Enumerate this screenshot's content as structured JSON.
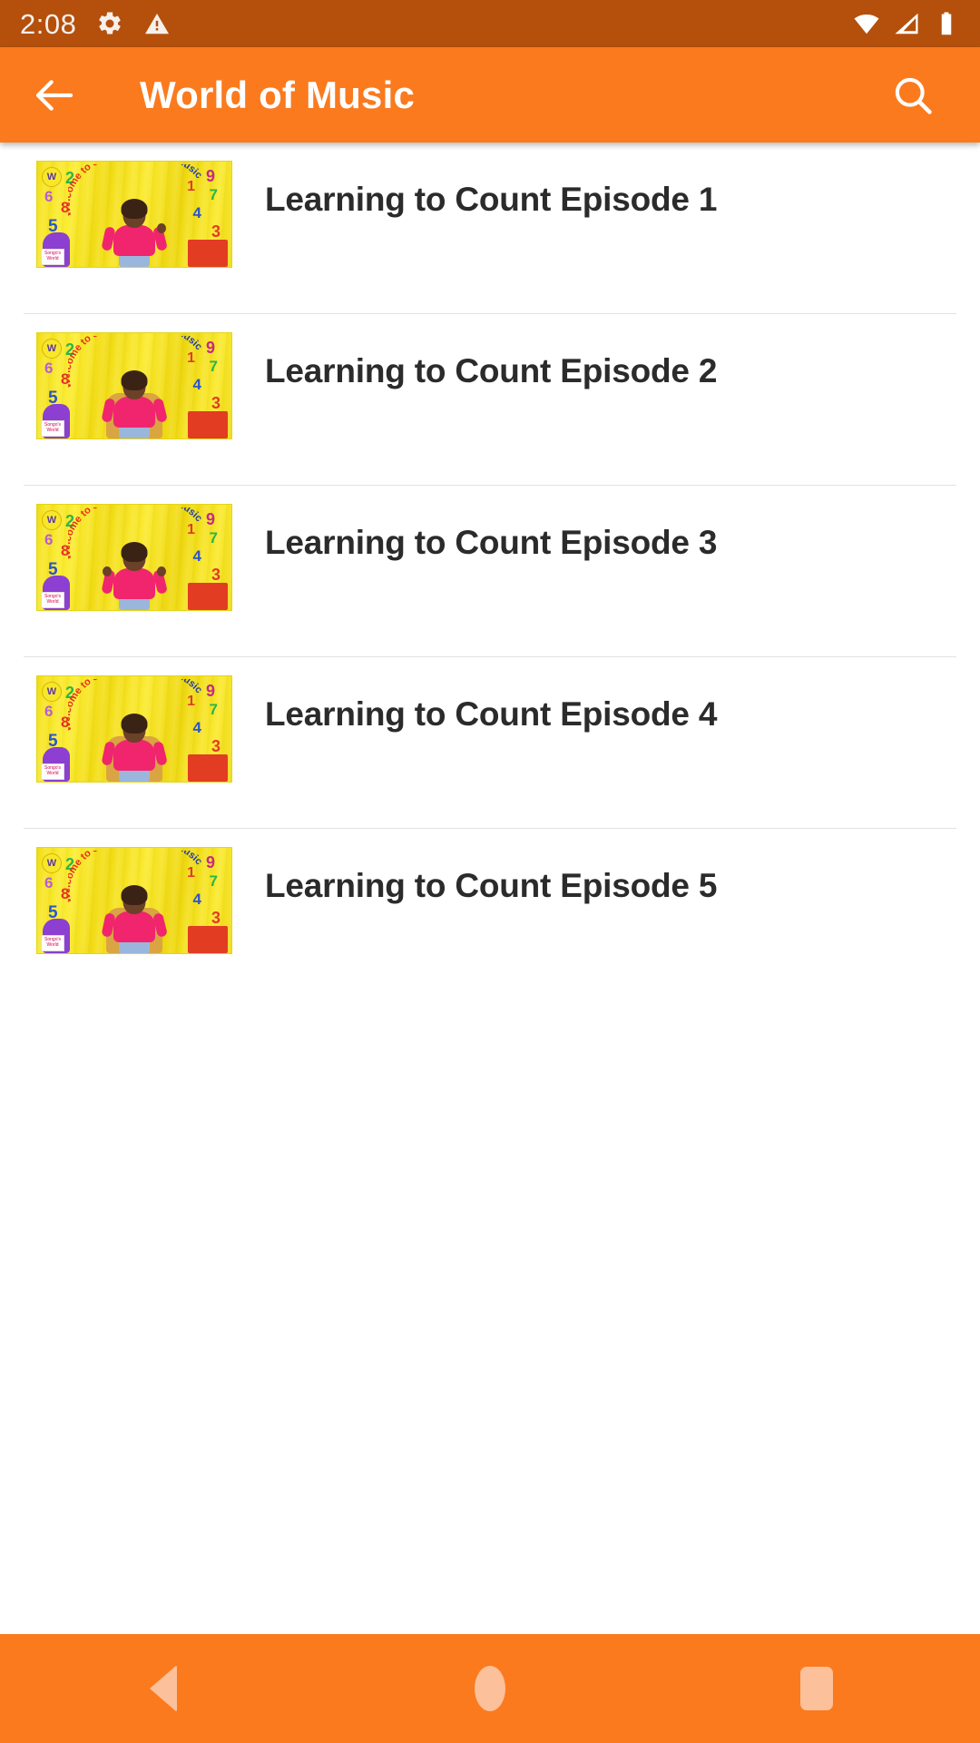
{
  "status_bar": {
    "time": "2:08",
    "background_color": "#B4500C",
    "icons": [
      {
        "name": "settings-gear-icon",
        "glyph": "gear"
      },
      {
        "name": "warning-triangle-icon",
        "glyph": "warning"
      },
      {
        "name": "wifi-icon",
        "glyph": "wifi"
      },
      {
        "name": "cellular-signal-icon",
        "glyph": "signal"
      },
      {
        "name": "battery-icon",
        "glyph": "battery"
      }
    ]
  },
  "app_bar": {
    "title": "World of Music",
    "background_color": "#FB7A1E",
    "title_color": "#FFFFFF",
    "back_icon": "arrow-back-icon",
    "search_icon": "search-icon"
  },
  "list": {
    "items": [
      {
        "title": "Learning to Count Episode 1",
        "thumbnail_text": "Welcome to Songo's World of Music"
      },
      {
        "title": "Learning to Count Episode 2",
        "thumbnail_text": "Welcome to Songo's World of Music"
      },
      {
        "title": "Learning to Count Episode 3",
        "thumbnail_text": "Welcome to Songo's World of Music"
      },
      {
        "title": "Learning to Count Episode 4",
        "thumbnail_text": "Welcome to Songo's World of Music"
      },
      {
        "title": "Learning to Count Episode 5",
        "thumbnail_text": "Welcome to Songo's World of Music"
      }
    ],
    "title_color": "#2B2B2B",
    "divider_color": "#E2E2E2",
    "background_color": "#FFFFFF"
  },
  "thumbnail_art": {
    "headline": "Welcome to Songo's World of Music",
    "numbers_left": [
      "2",
      "6",
      "8",
      "5"
    ],
    "numbers_right": [
      "9",
      "1",
      "7",
      "4",
      "3"
    ],
    "badge_letter": "W",
    "logo_caption": "Songo's World"
  },
  "nav_bar": {
    "background_color": "#FB7A1E",
    "icon_color": "#FCC09A",
    "buttons": [
      {
        "name": "nav-back-button",
        "label": "Back"
      },
      {
        "name": "nav-home-button",
        "label": "Home"
      },
      {
        "name": "nav-recents-button",
        "label": "Recents"
      }
    ]
  }
}
